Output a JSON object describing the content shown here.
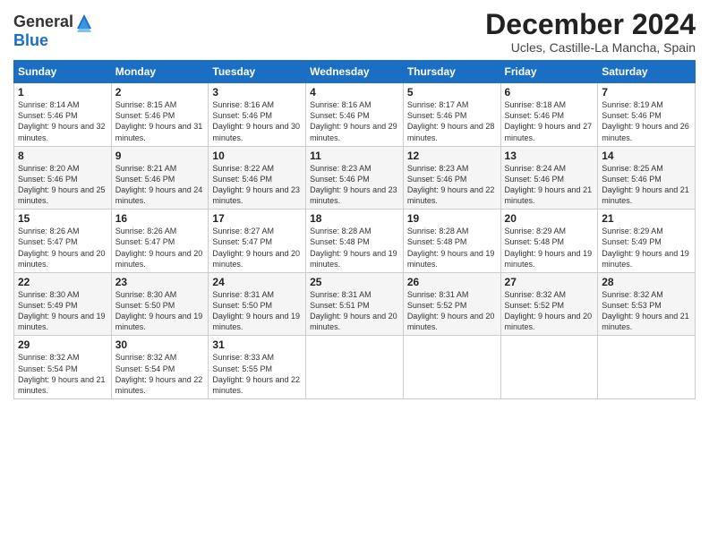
{
  "logo": {
    "general": "General",
    "blue": "Blue"
  },
  "title": "December 2024",
  "subtitle": "Ucles, Castille-La Mancha, Spain",
  "days_of_week": [
    "Sunday",
    "Monday",
    "Tuesday",
    "Wednesday",
    "Thursday",
    "Friday",
    "Saturday"
  ],
  "weeks": [
    [
      {
        "day": "1",
        "sunrise": "Sunrise: 8:14 AM",
        "sunset": "Sunset: 5:46 PM",
        "daylight": "Daylight: 9 hours and 32 minutes."
      },
      {
        "day": "2",
        "sunrise": "Sunrise: 8:15 AM",
        "sunset": "Sunset: 5:46 PM",
        "daylight": "Daylight: 9 hours and 31 minutes."
      },
      {
        "day": "3",
        "sunrise": "Sunrise: 8:16 AM",
        "sunset": "Sunset: 5:46 PM",
        "daylight": "Daylight: 9 hours and 30 minutes."
      },
      {
        "day": "4",
        "sunrise": "Sunrise: 8:16 AM",
        "sunset": "Sunset: 5:46 PM",
        "daylight": "Daylight: 9 hours and 29 minutes."
      },
      {
        "day": "5",
        "sunrise": "Sunrise: 8:17 AM",
        "sunset": "Sunset: 5:46 PM",
        "daylight": "Daylight: 9 hours and 28 minutes."
      },
      {
        "day": "6",
        "sunrise": "Sunrise: 8:18 AM",
        "sunset": "Sunset: 5:46 PM",
        "daylight": "Daylight: 9 hours and 27 minutes."
      },
      {
        "day": "7",
        "sunrise": "Sunrise: 8:19 AM",
        "sunset": "Sunset: 5:46 PM",
        "daylight": "Daylight: 9 hours and 26 minutes."
      }
    ],
    [
      {
        "day": "8",
        "sunrise": "Sunrise: 8:20 AM",
        "sunset": "Sunset: 5:46 PM",
        "daylight": "Daylight: 9 hours and 25 minutes."
      },
      {
        "day": "9",
        "sunrise": "Sunrise: 8:21 AM",
        "sunset": "Sunset: 5:46 PM",
        "daylight": "Daylight: 9 hours and 24 minutes."
      },
      {
        "day": "10",
        "sunrise": "Sunrise: 8:22 AM",
        "sunset": "Sunset: 5:46 PM",
        "daylight": "Daylight: 9 hours and 23 minutes."
      },
      {
        "day": "11",
        "sunrise": "Sunrise: 8:23 AM",
        "sunset": "Sunset: 5:46 PM",
        "daylight": "Daylight: 9 hours and 23 minutes."
      },
      {
        "day": "12",
        "sunrise": "Sunrise: 8:23 AM",
        "sunset": "Sunset: 5:46 PM",
        "daylight": "Daylight: 9 hours and 22 minutes."
      },
      {
        "day": "13",
        "sunrise": "Sunrise: 8:24 AM",
        "sunset": "Sunset: 5:46 PM",
        "daylight": "Daylight: 9 hours and 21 minutes."
      },
      {
        "day": "14",
        "sunrise": "Sunrise: 8:25 AM",
        "sunset": "Sunset: 5:46 PM",
        "daylight": "Daylight: 9 hours and 21 minutes."
      }
    ],
    [
      {
        "day": "15",
        "sunrise": "Sunrise: 8:26 AM",
        "sunset": "Sunset: 5:47 PM",
        "daylight": "Daylight: 9 hours and 20 minutes."
      },
      {
        "day": "16",
        "sunrise": "Sunrise: 8:26 AM",
        "sunset": "Sunset: 5:47 PM",
        "daylight": "Daylight: 9 hours and 20 minutes."
      },
      {
        "day": "17",
        "sunrise": "Sunrise: 8:27 AM",
        "sunset": "Sunset: 5:47 PM",
        "daylight": "Daylight: 9 hours and 20 minutes."
      },
      {
        "day": "18",
        "sunrise": "Sunrise: 8:28 AM",
        "sunset": "Sunset: 5:48 PM",
        "daylight": "Daylight: 9 hours and 19 minutes."
      },
      {
        "day": "19",
        "sunrise": "Sunrise: 8:28 AM",
        "sunset": "Sunset: 5:48 PM",
        "daylight": "Daylight: 9 hours and 19 minutes."
      },
      {
        "day": "20",
        "sunrise": "Sunrise: 8:29 AM",
        "sunset": "Sunset: 5:48 PM",
        "daylight": "Daylight: 9 hours and 19 minutes."
      },
      {
        "day": "21",
        "sunrise": "Sunrise: 8:29 AM",
        "sunset": "Sunset: 5:49 PM",
        "daylight": "Daylight: 9 hours and 19 minutes."
      }
    ],
    [
      {
        "day": "22",
        "sunrise": "Sunrise: 8:30 AM",
        "sunset": "Sunset: 5:49 PM",
        "daylight": "Daylight: 9 hours and 19 minutes."
      },
      {
        "day": "23",
        "sunrise": "Sunrise: 8:30 AM",
        "sunset": "Sunset: 5:50 PM",
        "daylight": "Daylight: 9 hours and 19 minutes."
      },
      {
        "day": "24",
        "sunrise": "Sunrise: 8:31 AM",
        "sunset": "Sunset: 5:50 PM",
        "daylight": "Daylight: 9 hours and 19 minutes."
      },
      {
        "day": "25",
        "sunrise": "Sunrise: 8:31 AM",
        "sunset": "Sunset: 5:51 PM",
        "daylight": "Daylight: 9 hours and 20 minutes."
      },
      {
        "day": "26",
        "sunrise": "Sunrise: 8:31 AM",
        "sunset": "Sunset: 5:52 PM",
        "daylight": "Daylight: 9 hours and 20 minutes."
      },
      {
        "day": "27",
        "sunrise": "Sunrise: 8:32 AM",
        "sunset": "Sunset: 5:52 PM",
        "daylight": "Daylight: 9 hours and 20 minutes."
      },
      {
        "day": "28",
        "sunrise": "Sunrise: 8:32 AM",
        "sunset": "Sunset: 5:53 PM",
        "daylight": "Daylight: 9 hours and 21 minutes."
      }
    ],
    [
      {
        "day": "29",
        "sunrise": "Sunrise: 8:32 AM",
        "sunset": "Sunset: 5:54 PM",
        "daylight": "Daylight: 9 hours and 21 minutes."
      },
      {
        "day": "30",
        "sunrise": "Sunrise: 8:32 AM",
        "sunset": "Sunset: 5:54 PM",
        "daylight": "Daylight: 9 hours and 22 minutes."
      },
      {
        "day": "31",
        "sunrise": "Sunrise: 8:33 AM",
        "sunset": "Sunset: 5:55 PM",
        "daylight": "Daylight: 9 hours and 22 minutes."
      },
      null,
      null,
      null,
      null
    ]
  ]
}
